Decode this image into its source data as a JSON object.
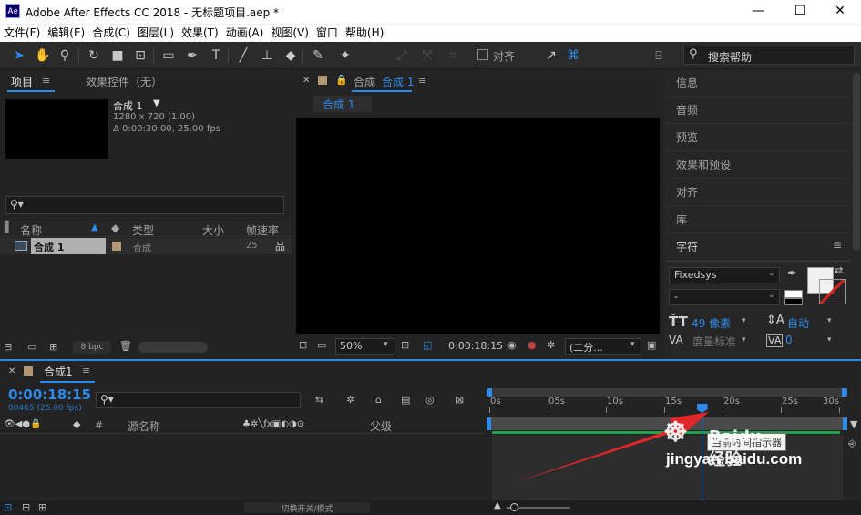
{
  "window": {
    "title": "Adobe After Effects CC 2018 - 无标题项目.aep *",
    "app_badge": "Ae",
    "minimize": "—",
    "maximize": "☐",
    "close": "✕"
  },
  "menu": [
    "文件(F)",
    "编辑(E)",
    "合成(C)",
    "图层(L)",
    "效果(T)",
    "动画(A)",
    "视图(V)",
    "窗口",
    "帮助(H)"
  ],
  "toolbar": {
    "align_label": "对齐",
    "search_placeholder": "搜索帮助"
  },
  "project_panel": {
    "tab_project": "项目",
    "tab_effects": "效果控件（无）",
    "comp_name": "合成 1",
    "comp_res": "1280 x 720 (1.00)",
    "comp_duration": "Δ 0:00:30:00, 25.00 fps",
    "columns": {
      "name": "名称",
      "type": "类型",
      "size": "大小",
      "fps": "帧速率"
    },
    "rows": [
      {
        "name": "合成 1",
        "type": "合成",
        "fps": "25"
      }
    ],
    "bpc": "8 bpc"
  },
  "comp_viewer": {
    "tab_label": "合成",
    "tab_comp": "合成 1",
    "subtab": "合成 1",
    "zoom": "50%",
    "timecode": "0:00:18:15",
    "resolution": "(二分..."
  },
  "right_panel": {
    "items": [
      "信息",
      "音频",
      "预览",
      "效果和预设",
      "对齐",
      "库",
      "字符"
    ],
    "font_family": "Fixedsys",
    "font_style": "-",
    "font_size": "49 像素",
    "leading": "自动",
    "tracking_label": "度量标准",
    "tracking_value": "0"
  },
  "timeline": {
    "tab": "合成1",
    "timecode": "0:00:18:15",
    "frame_info": "00465 (25.00 fps)",
    "col_source": "源名称",
    "col_parent": "父级",
    "ruler": [
      "0s",
      "05s",
      "10s",
      "15s",
      "20s",
      "25s",
      "30s"
    ],
    "tooltip": "当前时间指示器",
    "toggle_label": "切换开关/模式",
    "playhead_fraction": 0.6083
  },
  "watermark": {
    "site": "jingyan.baidu.com",
    "brand": "Baidu 经验"
  },
  "colors": {
    "accent": "#2d8ceb",
    "panel": "#232323",
    "arrow": "#e0262b"
  }
}
